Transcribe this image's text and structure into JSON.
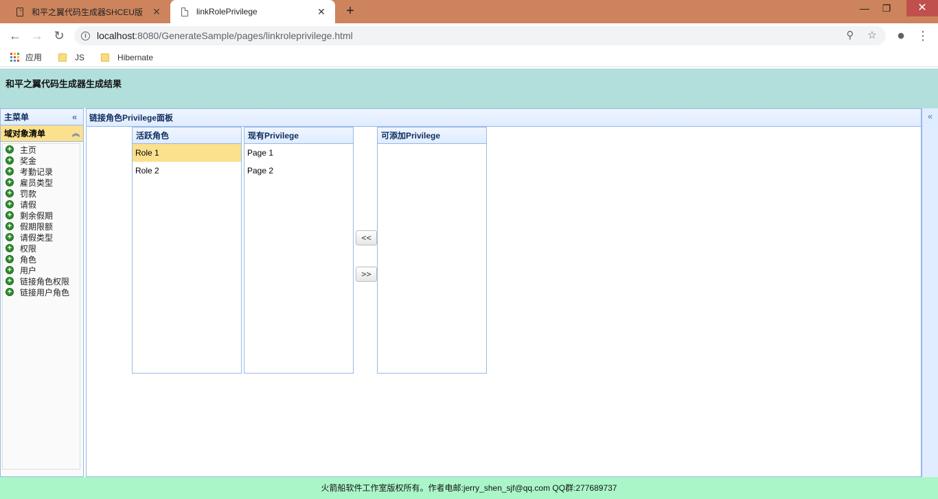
{
  "browser": {
    "tabs": [
      {
        "title": "和平之翼代码生成器SHCEU版",
        "active": false
      },
      {
        "title": "linkRolePrivilege",
        "active": true
      }
    ],
    "url_host": "localhost",
    "url_rest": ":8080/GenerateSample/pages/linkroleprivilege.html",
    "bookmarks": [
      {
        "label": "应用",
        "icon": "apps-icon"
      },
      {
        "label": "JS",
        "icon": "folder-icon"
      },
      {
        "label": "Hibernate",
        "icon": "folder-icon"
      }
    ]
  },
  "page": {
    "title": "和平之翼代码生成器生成结果",
    "west": {
      "title": "主菜单",
      "accordion_title": "域对象清单",
      "menu_items": [
        "主页",
        "奖金",
        "考勤记录",
        "雇员类型",
        "罚款",
        "请假",
        "剩余假期",
        "假期限额",
        "请假类型",
        "权限",
        "角色",
        "用户",
        "链接角色权限",
        "链接用户角色"
      ]
    },
    "center": {
      "title": "链接角色Privilege面板",
      "active_roles": {
        "title": "活跃角色",
        "items": [
          "Role 1",
          "Role 2"
        ],
        "selected": "Role 1"
      },
      "current_privileges": {
        "title": "现有Privilege",
        "items": [
          "Page 1",
          "Page 2"
        ]
      },
      "available_privileges": {
        "title": "可添加Privilege",
        "items": []
      },
      "add_button": "<<",
      "remove_button": ">>"
    },
    "footer": "火箭船软件工作室版权所有。作者电邮:jerry_shen_sjf@qq.com QQ群:277689737"
  },
  "colors": {
    "tabbar": "#cd845c",
    "header": "#b2dfdb",
    "footer": "#abf6c9",
    "panel_border": "#95b8e7",
    "selected": "#fbe08d"
  }
}
